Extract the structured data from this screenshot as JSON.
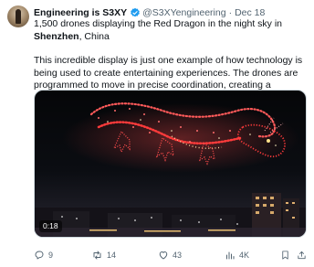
{
  "author": {
    "name": "Engineering is S3ΧY",
    "handle": "@S3XYengineering",
    "separator": "·",
    "date": "Dec 18",
    "verified": true,
    "avatar_icon": "avatar-photo"
  },
  "tweet": {
    "line1_pre": "1,500 drones displaying the Red Dragon in the night sky in ",
    "line1_bold": "Shenzhen",
    "line1_post": ", China",
    "paragraph2": "This incredible display is just one example of how technology is being used to create entertaining experiences. The drones are programmed to move in precise coordination, creating a mesmerizing view"
  },
  "media": {
    "type": "video",
    "timestamp": "0:18"
  },
  "actions": {
    "replies": "9",
    "reposts": "14",
    "likes": "43",
    "views": "4K"
  },
  "colors": {
    "accent": "#1d9bf0",
    "text": "#0f1419",
    "secondary": "#536471",
    "dragon_red": "#ff3b3b"
  }
}
